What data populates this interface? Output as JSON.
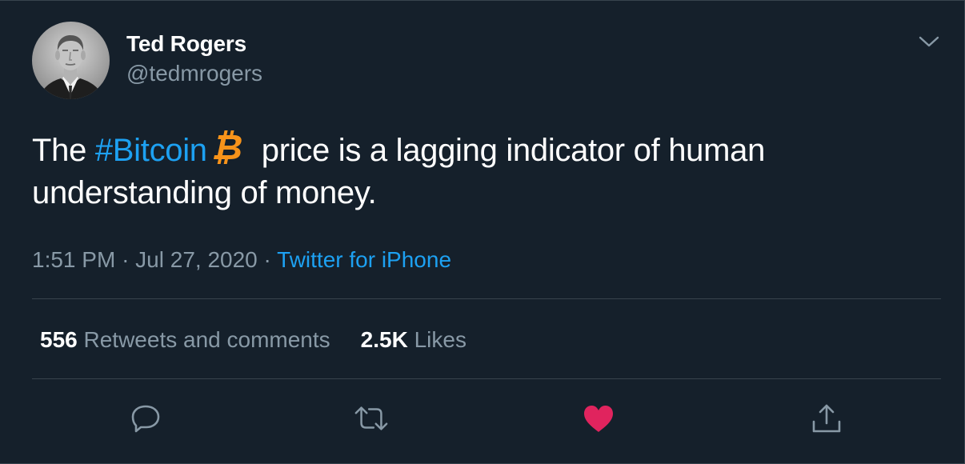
{
  "author": {
    "name": "Ted Rogers",
    "handle": "@tedmrogers",
    "avatar_icon": "avatar-portrait"
  },
  "tweet": {
    "text_before": "The ",
    "hashtag": "#Bitcoin",
    "emoji_icon": "bitcoin-icon",
    "text_after": "price is a lagging indicator of human understanding of money."
  },
  "meta": {
    "time": "1:51 PM",
    "separator": "·",
    "date": "Jul 27, 2020",
    "source": "Twitter for iPhone"
  },
  "stats": {
    "retweets_count": "556",
    "retweets_label": "Retweets and comments",
    "likes_count": "2.5K",
    "likes_label": "Likes"
  },
  "actions": [
    "reply-icon",
    "retweet-icon",
    "heart-icon",
    "share-icon"
  ],
  "colors": {
    "background": "#15202b",
    "text": "#ffffff",
    "secondary": "#8899a6",
    "accent": "#1da1f2",
    "like": "#e0245e",
    "bitcoin": "#f7931a",
    "divider": "#38444d"
  }
}
